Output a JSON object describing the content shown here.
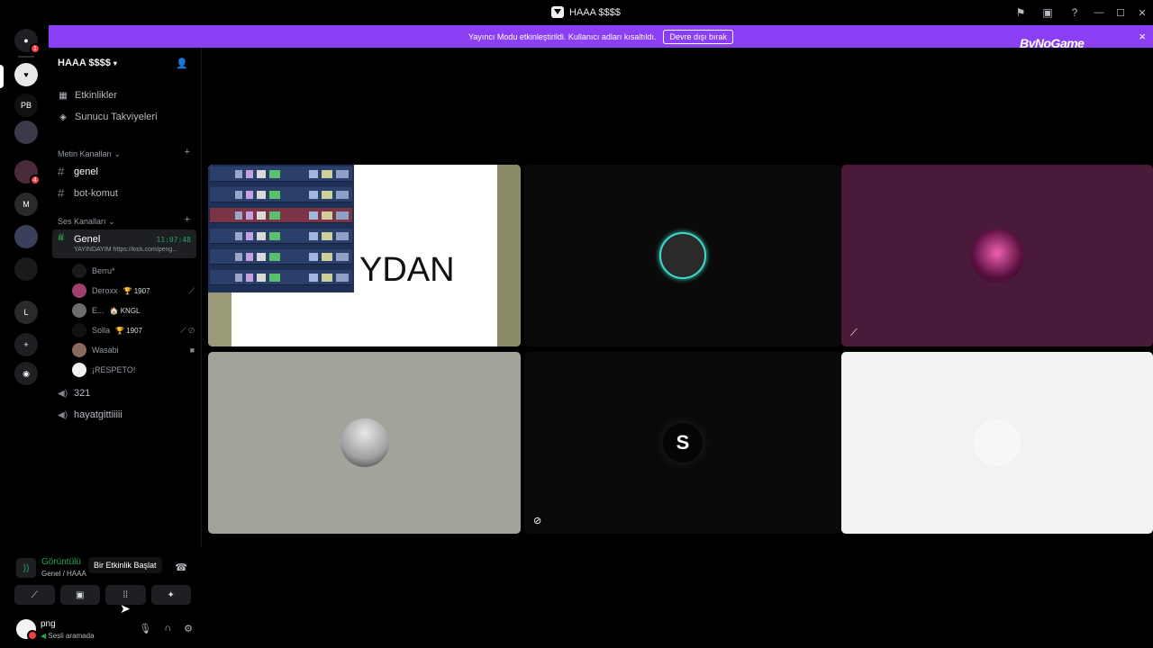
{
  "window": {
    "title": "HAAA $$$$"
  },
  "banner": {
    "message": "Yayıncı Modu etkinleştirildi. Kullanıcı adları kısaltıldı.",
    "button": "Devre dışı bırak",
    "close": "×",
    "brand": "ByNoGame"
  },
  "server_rail": {
    "items": [
      {
        "label": "",
        "icon": "discord-home",
        "badge": "1"
      },
      {
        "label": "",
        "icon": "server-active"
      },
      {
        "label": "PB",
        "icon": "server"
      },
      {
        "label": "",
        "icon": "server"
      },
      {
        "label": "",
        "icon": "server-group",
        "badge": "4"
      },
      {
        "label": "M",
        "icon": "server"
      },
      {
        "label": "",
        "icon": "server"
      },
      {
        "label": "",
        "icon": "server"
      },
      {
        "label": "L",
        "icon": "server-group"
      },
      {
        "label": "+",
        "icon": "add-server"
      },
      {
        "label": "",
        "icon": "discover"
      }
    ]
  },
  "sidebar": {
    "server_name": "HAAA $$$$",
    "nav": [
      {
        "label": "Etkinlikler",
        "icon": "calendar-icon"
      },
      {
        "label": "Sunucu Takviyeleri",
        "icon": "boost-icon"
      }
    ],
    "text_category": "Metin Kanalları",
    "text_channels": [
      "genel",
      "bot-komut"
    ],
    "voice_category": "Ses Kanalları",
    "active_voice": {
      "name": "Genel",
      "time": "11:07:48",
      "status": "YAYINDAYIM https://kick.com/peng..."
    },
    "members": [
      {
        "name": "Berru*",
        "tag": "",
        "avatar": "#2a2a2a"
      },
      {
        "name": "Deroxx",
        "tag": "🏆 1907",
        "avatar": "#a04070"
      },
      {
        "name": "E...",
        "tag": "🏠 KNGL",
        "avatar": "#6d6d6d"
      },
      {
        "name": "Solla",
        "tag": "🏆 1907",
        "avatar": "#111111"
      },
      {
        "name": "Wasabi",
        "tag": "",
        "avatar": "#8a6a5a"
      },
      {
        "name": "¡RESPETO!",
        "tag": "",
        "avatar": "#f2f2f2"
      }
    ],
    "voice_channels": [
      "321",
      "hayatgittiiiii"
    ]
  },
  "voice_panel": {
    "title": "Görüntülü",
    "subtitle": "Genel / HAAA",
    "tooltip": "Bir Etkinlik Başlat"
  },
  "user": {
    "name": "png",
    "status": "Sesli aramada"
  },
  "stage": {
    "screen_text": "YDAN",
    "tile_letter": "S"
  },
  "colors": {
    "accent": "#8b3ff4",
    "online": "#23a55a",
    "danger": "#f23f43",
    "tile_purple": "#4a1a3a",
    "tile_grey": "#a3a39b"
  }
}
